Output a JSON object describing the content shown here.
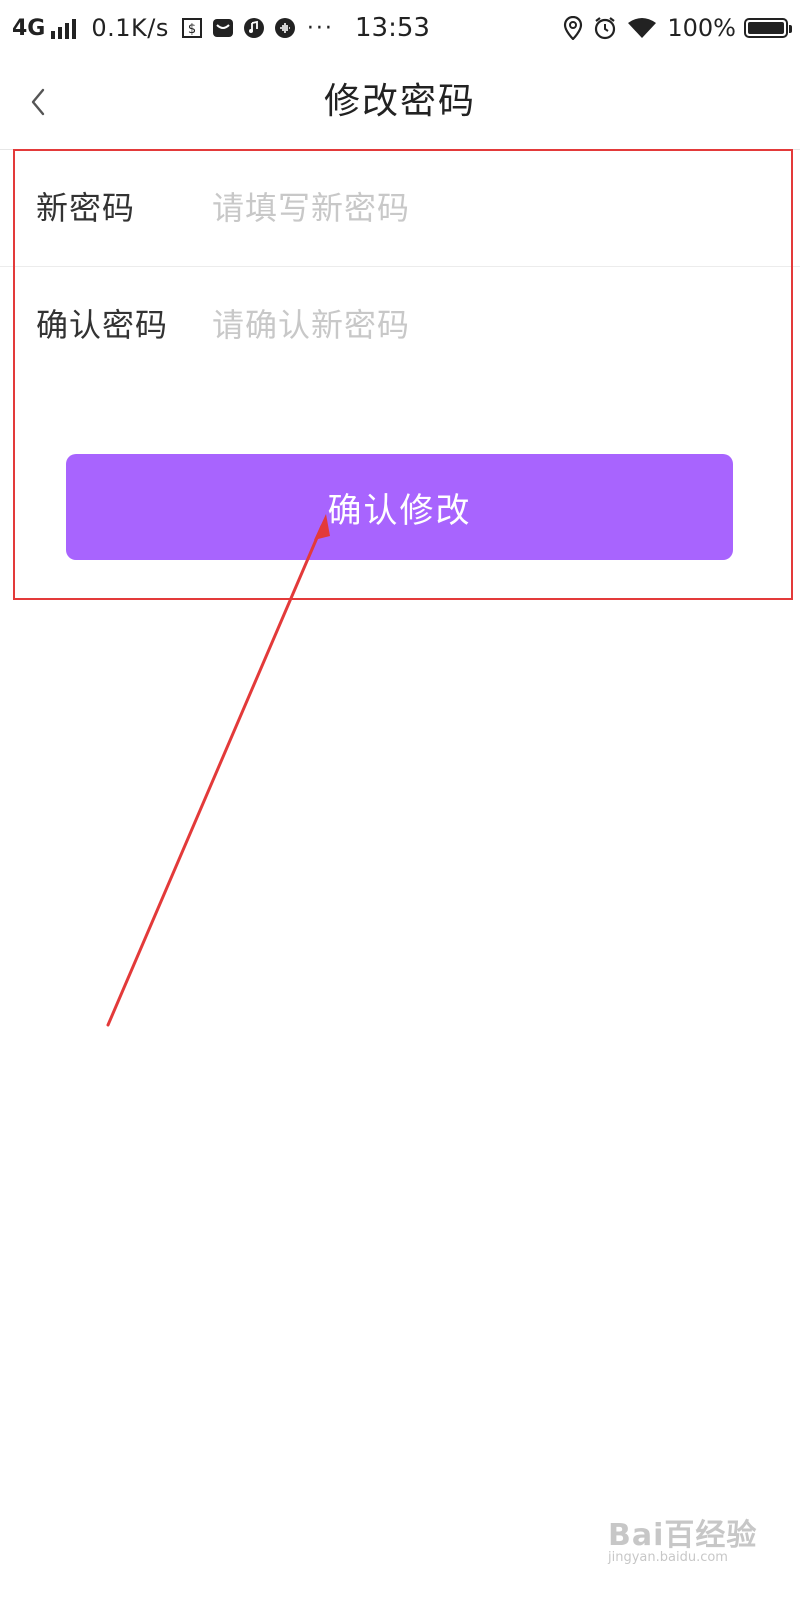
{
  "status_bar": {
    "network": "4G",
    "speed": "0.1K/s",
    "time": "13:53",
    "battery_percent": "100%",
    "battery_level": 1.0,
    "icons_left": [
      "dollar-notification-icon",
      "message-notification-icon",
      "music-notification-icon",
      "audio-notification-icon"
    ],
    "icons_right": [
      "location-icon",
      "alarm-icon",
      "wifi-icon"
    ],
    "more": "···"
  },
  "header": {
    "title": "修改密码",
    "back_icon": "chevron-left-icon"
  },
  "form": {
    "new_password": {
      "label": "新密码",
      "value": "",
      "placeholder": "请填写新密码"
    },
    "confirm_password": {
      "label": "确认密码",
      "value": "",
      "placeholder": "请确认新密码"
    },
    "submit_label": "确认修改"
  },
  "colors": {
    "accent": "#a864fe",
    "annotation": "#e33a3a",
    "placeholder": "#c8c8c8",
    "text": "#333333"
  },
  "watermark": {
    "logo": "Bai百经验",
    "domain": "jingyan.baidu.com"
  }
}
